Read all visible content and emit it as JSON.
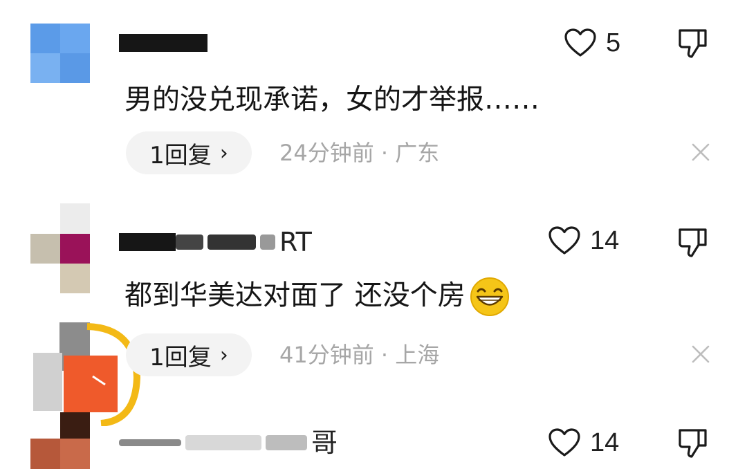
{
  "comments": [
    {
      "username_visible": "",
      "likes": "5",
      "text": "男的没兑现承诺，女的才举报……",
      "reply_label": "1回复",
      "reply_chevron": "›",
      "time": "24分钟前",
      "separator": "·",
      "location": "广东"
    },
    {
      "username_visible": "RT",
      "likes": "14",
      "text": "都到华美达对面了 还没个房",
      "emoji": "grinning-face-emoji",
      "reply_label": "1回复",
      "reply_chevron": "›",
      "time": "41分钟前",
      "separator": "·",
      "location": "上海"
    },
    {
      "username_visible": "哥",
      "likes": "14"
    }
  ],
  "icons": {
    "like": "heart-outline-icon",
    "dislike": "thumbs-down-icon",
    "close": "close-icon"
  },
  "colors": {
    "meta_text": "#a6a6a6",
    "reply_pill_bg": "#f3f3f3",
    "emoji_yellow": "#f5c518"
  }
}
